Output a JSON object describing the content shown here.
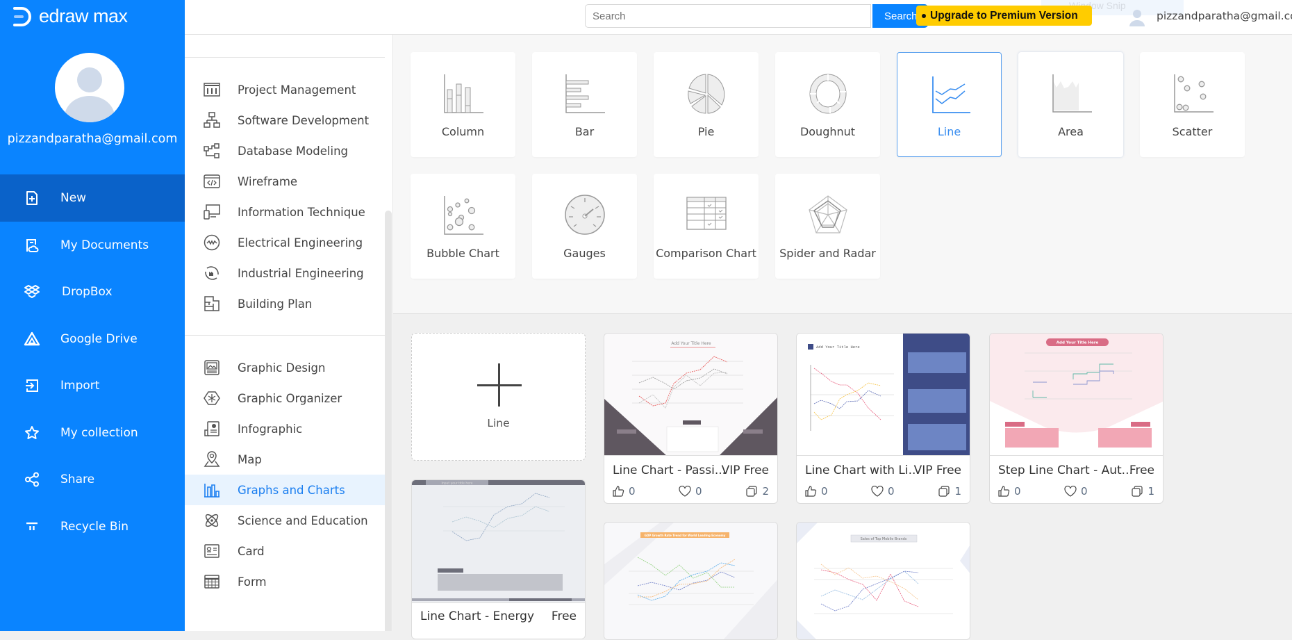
{
  "app": {
    "brand": "edraw max"
  },
  "user": {
    "email": "pizzandparatha@gmail.com"
  },
  "topbar": {
    "search_placeholder": "Search",
    "search_button": "Search",
    "upgrade_label": "Upgrade to Premium Version",
    "window_snip": "Window Snip",
    "user_email": "pizzandparatha@gmail.com"
  },
  "sidebar": {
    "items": [
      {
        "label": "New",
        "icon": "new-file-icon",
        "active": true
      },
      {
        "label": "My Documents",
        "icon": "cloud-document-icon"
      },
      {
        "label": "DropBox",
        "icon": "dropbox-icon"
      },
      {
        "label": "Google Drive",
        "icon": "google-drive-icon"
      },
      {
        "label": "Import",
        "icon": "import-icon"
      },
      {
        "label": "My collection",
        "icon": "star-icon"
      },
      {
        "label": "Share",
        "icon": "share-icon"
      },
      {
        "label": "Recycle Bin",
        "icon": "recycle-bin-icon"
      }
    ]
  },
  "categories": {
    "group1": [
      {
        "label": "Project Management",
        "icon": "project-management-icon"
      },
      {
        "label": "Software Development",
        "icon": "software-development-icon"
      },
      {
        "label": "Database Modeling",
        "icon": "database-modeling-icon"
      },
      {
        "label": "Wireframe",
        "icon": "wireframe-icon"
      },
      {
        "label": "Information Technique",
        "icon": "information-technique-icon"
      },
      {
        "label": "Electrical Engineering",
        "icon": "electrical-engineering-icon"
      },
      {
        "label": "Industrial Engineering",
        "icon": "industrial-engineering-icon"
      },
      {
        "label": "Building Plan",
        "icon": "building-plan-icon"
      }
    ],
    "group2": [
      {
        "label": "Graphic Design",
        "icon": "graphic-design-icon"
      },
      {
        "label": "Graphic Organizer",
        "icon": "graphic-organizer-icon"
      },
      {
        "label": "Infographic",
        "icon": "infographic-icon"
      },
      {
        "label": "Map",
        "icon": "map-pin-icon"
      },
      {
        "label": "Graphs and Charts",
        "icon": "bar-chart-icon",
        "active": true
      },
      {
        "label": "Science and Education",
        "icon": "atom-icon"
      },
      {
        "label": "Card",
        "icon": "card-icon"
      },
      {
        "label": "Form",
        "icon": "form-icon"
      }
    ]
  },
  "chart_types": [
    {
      "label": "Column",
      "icon": "column-chart-icon"
    },
    {
      "label": "Bar",
      "icon": "bar-chart-icon"
    },
    {
      "label": "Pie",
      "icon": "pie-chart-icon"
    },
    {
      "label": "Doughnut",
      "icon": "doughnut-chart-icon"
    },
    {
      "label": "Line",
      "icon": "line-chart-icon",
      "active": true
    },
    {
      "label": "Area",
      "icon": "area-chart-icon"
    },
    {
      "label": "Scatter",
      "icon": "scatter-chart-icon"
    },
    {
      "label": "Bubble Chart",
      "icon": "bubble-chart-icon"
    },
    {
      "label": "Gauges",
      "icon": "gauge-icon"
    },
    {
      "label": "Comparison Chart",
      "icon": "comparison-chart-icon"
    },
    {
      "label": "Spider and Radar",
      "icon": "radar-chart-icon"
    }
  ],
  "new_blank": {
    "label": "Line"
  },
  "templates": [
    {
      "title": "Line Chart - Passi...",
      "badge": "VIP Free",
      "likes": "0",
      "favorites": "0",
      "copies": "2",
      "thumb_title": "Add Your Title Here",
      "accent": "#5f5760"
    },
    {
      "title": "Line Chart with Li...",
      "badge": "VIP Free",
      "likes": "0",
      "favorites": "0",
      "copies": "1",
      "thumb_title": "Add Your Title Here",
      "accent": "#3e4c87"
    },
    {
      "title": "Step Line Chart - Aut...",
      "badge": "Free",
      "likes": "0",
      "favorites": "0",
      "copies": "1",
      "thumb_title": "Add Your Title Here",
      "accent": "#d96c85"
    },
    {
      "title": "Line Chart - Energy",
      "badge": "Free",
      "thumb_title": "Input your title here",
      "accent": "#6d6e7a"
    },
    {
      "title": "",
      "badge": "",
      "thumb_title": "GDP Growth Rate Trend for World Leading Economy",
      "accent": "#f6b36b"
    },
    {
      "title": "",
      "badge": "",
      "thumb_title": "Sales of Top Mobile Brands",
      "accent": "#c9ccd6"
    }
  ],
  "colors": {
    "brand": "#0a84ff",
    "brand_active": "#0a62c9",
    "upgrade": "#ffcc00",
    "selected_text": "#1a7ef0"
  }
}
